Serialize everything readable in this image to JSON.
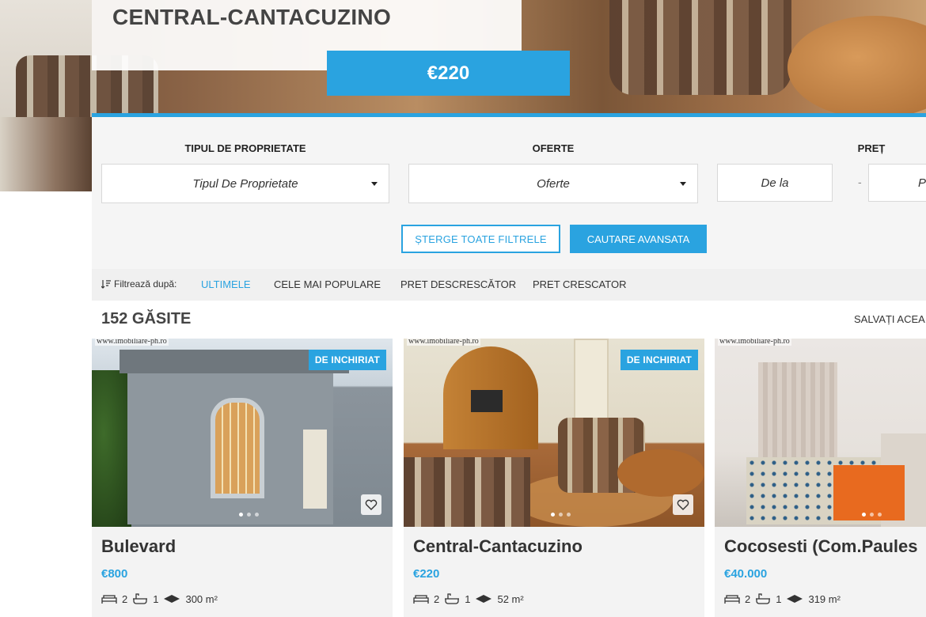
{
  "listing": {
    "title": "CENTRAL-CANTACUZINO",
    "price": "€220"
  },
  "filters": {
    "property_type": {
      "label": "TIPUL DE PROPRIETATE",
      "value": "Tipul De Proprietate"
    },
    "offers": {
      "label": "OFERTE",
      "value": "Oferte"
    },
    "price": {
      "label": "PREȚ",
      "from_placeholder": "De la",
      "to_placeholder": "P",
      "separator": "-"
    },
    "clear_button": "ȘTERGE TOATE FILTRELE",
    "advanced_button": "CAUTARE AVANSATA"
  },
  "sort": {
    "label": "Filtrează după:",
    "options": [
      "ULTIMELE",
      "CELE MAI POPULARE",
      "PRET DESCRESCĂTOR",
      "PRET CRESCATOR"
    ],
    "active": "ULTIMELE"
  },
  "results": {
    "count_text": "152 GĂSITE",
    "save_search": "SALVAȚI ACEA"
  },
  "cards": [
    {
      "watermark": "www.imobiliare-ph.ro",
      "badge": "DE INCHIRIAT",
      "name": "Bulevard",
      "price": "€800",
      "beds": "2",
      "baths": "1",
      "area": "300 m²"
    },
    {
      "watermark": "www.imobiliare-ph.ro",
      "badge": "DE INCHIRIAT",
      "name": "Central-Cantacuzino",
      "price": "€220",
      "beds": "2",
      "baths": "1",
      "area": "52 m²"
    },
    {
      "watermark": "www.imobiliare-ph.ro",
      "badge": "",
      "name": "Cocosesti (Com.Pаules",
      "price": "€40.000",
      "beds": "2",
      "baths": "1",
      "area": "319 m²"
    }
  ],
  "colors": {
    "accent": "#2aa3e0",
    "panel": "#f5f5f5",
    "title": "#444444"
  },
  "icons": [
    "sort-icon",
    "caret-down-icon",
    "heart-icon",
    "bed-icon",
    "bath-icon",
    "area-icon"
  ]
}
